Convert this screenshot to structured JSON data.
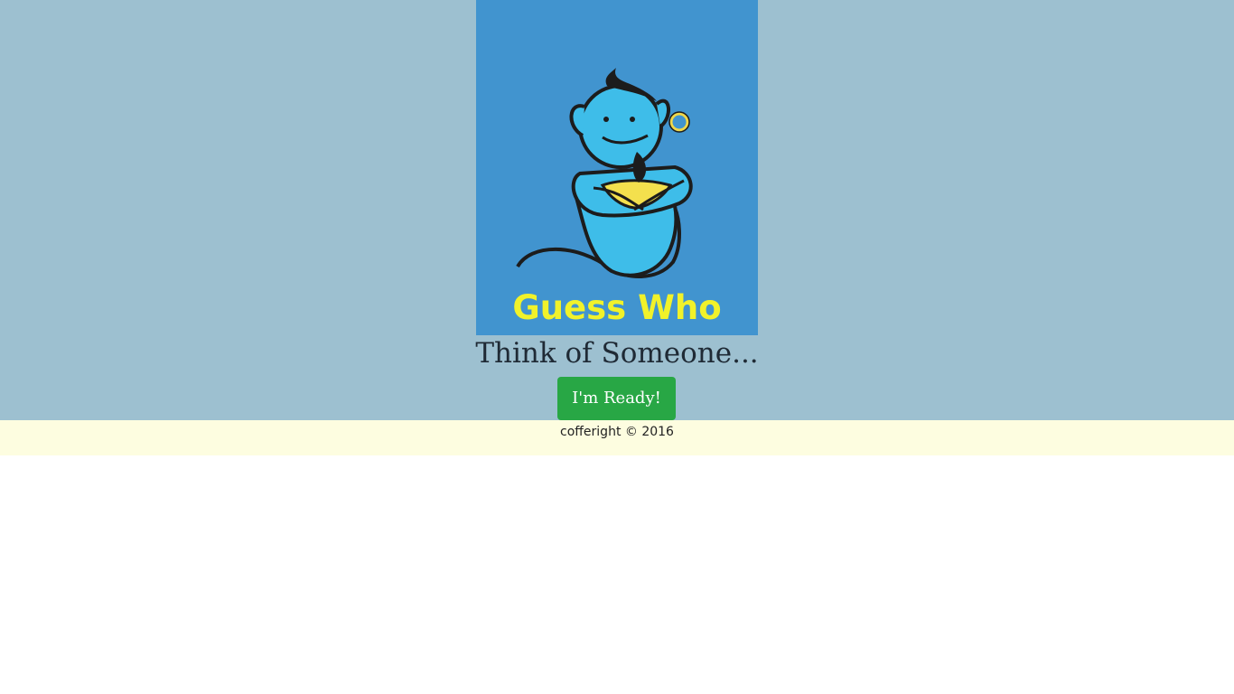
{
  "logo": {
    "title": "Guess Who",
    "icon": "genie-mascot-icon",
    "panel_color": "#4194cf",
    "title_color": "#f1f22a"
  },
  "main": {
    "tagline": "Think of Someone...",
    "ready_button_label": "I'm Ready!",
    "ready_button_color": "#28a745"
  },
  "footer": {
    "copyright": "cofferight © 2016"
  },
  "colors": {
    "hero_background": "#9dc0d0",
    "footer_background": "#fdfde0"
  }
}
